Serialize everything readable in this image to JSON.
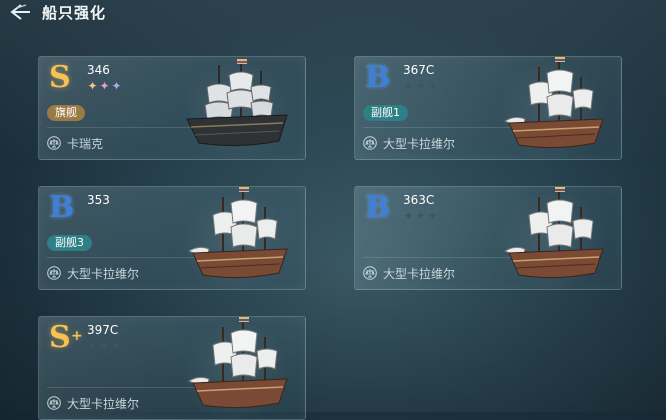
{
  "header": {
    "title": "船只强化",
    "back_icon": "back-arrow-icon"
  },
  "colors": {
    "grade_s": "#f5c253",
    "grade_b": "#3e7fd8",
    "flag_badge": "#9a7b44",
    "sub_badge": "#2f7f86"
  },
  "ships": [
    {
      "grade": "S",
      "grade_plus": "",
      "id": "346",
      "stars": [
        "lit",
        "lit",
        "lit"
      ],
      "role": "旗舰",
      "type": "卡瑞克",
      "hull": "dark"
    },
    {
      "grade": "B",
      "grade_plus": "",
      "id": "367C",
      "stars": [
        "dim",
        "dim",
        "dim"
      ],
      "role": "副舰1",
      "type": "大型卡拉维尔",
      "hull": "wood"
    },
    {
      "grade": "B",
      "grade_plus": "",
      "id": "353",
      "stars": [
        "dim",
        "dim",
        "dim"
      ],
      "role": "副舰3",
      "type": "大型卡拉维尔",
      "hull": "wood"
    },
    {
      "grade": "B",
      "grade_plus": "",
      "id": "363C",
      "stars": [
        "dim",
        "dim",
        "dim"
      ],
      "role": "",
      "type": "大型卡拉维尔",
      "hull": "wood"
    },
    {
      "grade": "S",
      "grade_plus": "+",
      "id": "397C",
      "stars": [
        "dim",
        "dim",
        "dim"
      ],
      "role": "",
      "type": "大型卡拉维尔",
      "hull": "wood"
    }
  ]
}
